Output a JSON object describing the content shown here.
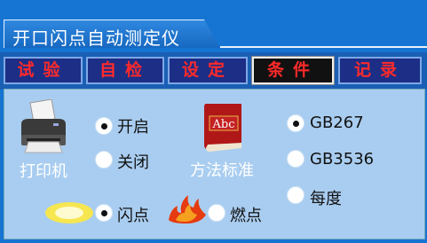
{
  "title": "开口闪点自动测定仪",
  "tabs": [
    {
      "label": "试验",
      "active": false
    },
    {
      "label": "自检",
      "active": false
    },
    {
      "label": "设定",
      "active": false
    },
    {
      "label": "条件",
      "active": true
    },
    {
      "label": "记录",
      "active": false
    }
  ],
  "printer": {
    "label": "打印机",
    "icon": "printer-icon",
    "options": [
      {
        "label": "开启",
        "selected": true
      },
      {
        "label": "关闭",
        "selected": false
      }
    ]
  },
  "method": {
    "label": "方法标准",
    "icon": "book-icon",
    "icon_text": "Abc",
    "options": [
      {
        "label": "GB267",
        "selected": true
      },
      {
        "label": "GB3536",
        "selected": false
      },
      {
        "label": "每度",
        "selected": false
      }
    ]
  },
  "point": {
    "options": [
      {
        "label": "闪点",
        "selected": true,
        "icon": "flash-icon"
      },
      {
        "label": "燃点",
        "selected": false,
        "icon": "fire-icon"
      }
    ]
  },
  "colors": {
    "background": "#1674d2",
    "panel": "#a9cdf0",
    "tab_text": "#ff2a2a",
    "tab_bg": "#1c2e86"
  }
}
